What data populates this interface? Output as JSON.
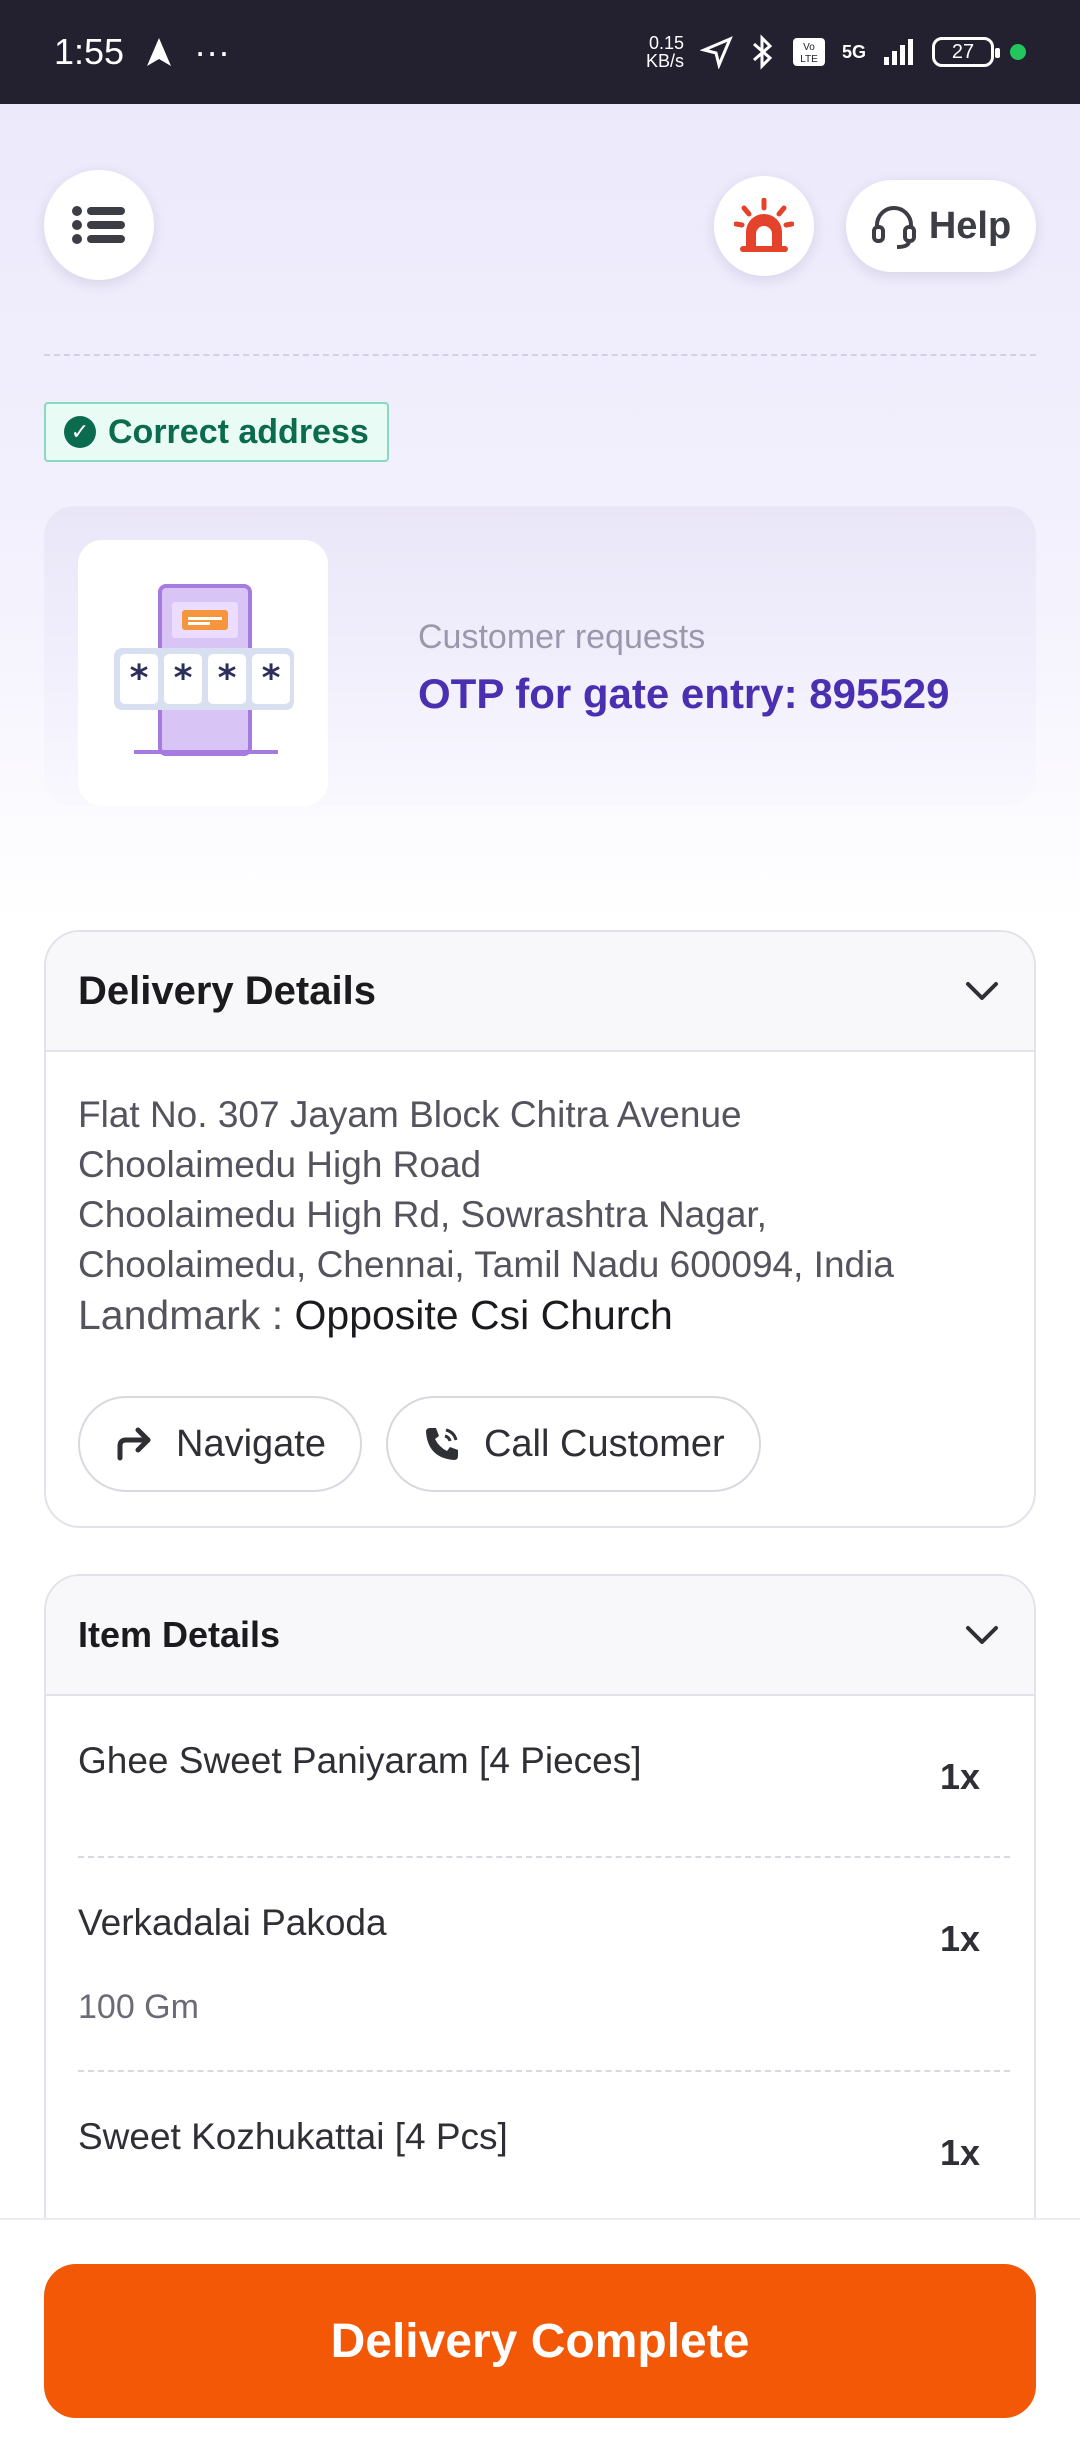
{
  "status_bar": {
    "time": "1:55",
    "more": "···",
    "net_speed": "0.15",
    "net_unit": "KB/s",
    "network": "5G",
    "battery": "27"
  },
  "header": {
    "help_label": "Help",
    "menu_icon": "list-icon",
    "alert_icon": "siren-icon"
  },
  "address_tag": "Correct address",
  "otp": {
    "subtitle": "Customer requests",
    "text": "OTP for gate entry: 895529",
    "illustration": "otp-gate-illustration"
  },
  "delivery_details": {
    "title": "Delivery Details",
    "address_lines": [
      "Flat No. 307 Jayam Block Chitra Avenue",
      "Choolaimedu High Road",
      "Choolaimedu High Rd, Sowrashtra Nagar,",
      "Choolaimedu, Chennai, Tamil Nadu 600094, India"
    ],
    "landmark_label": "Landmark : ",
    "landmark_value": "Opposite Csi Church",
    "navigate_label": "Navigate",
    "call_label": "Call Customer"
  },
  "item_details": {
    "title": "Item Details",
    "items": [
      {
        "name": "Ghee Sweet Paniyaram [4 Pieces]",
        "qty": "1x",
        "sub": ""
      },
      {
        "name": "Verkadalai Pakoda",
        "qty": "1x",
        "sub": "100 Gm"
      },
      {
        "name": "Sweet Kozhukattai [4 Pcs]",
        "qty": "1x",
        "sub": ""
      }
    ]
  },
  "footer": {
    "complete_label": "Delivery Complete"
  },
  "colors": {
    "accent": "#f25806",
    "otp_text": "#4a2fb0",
    "success": "#0b6b4d"
  }
}
